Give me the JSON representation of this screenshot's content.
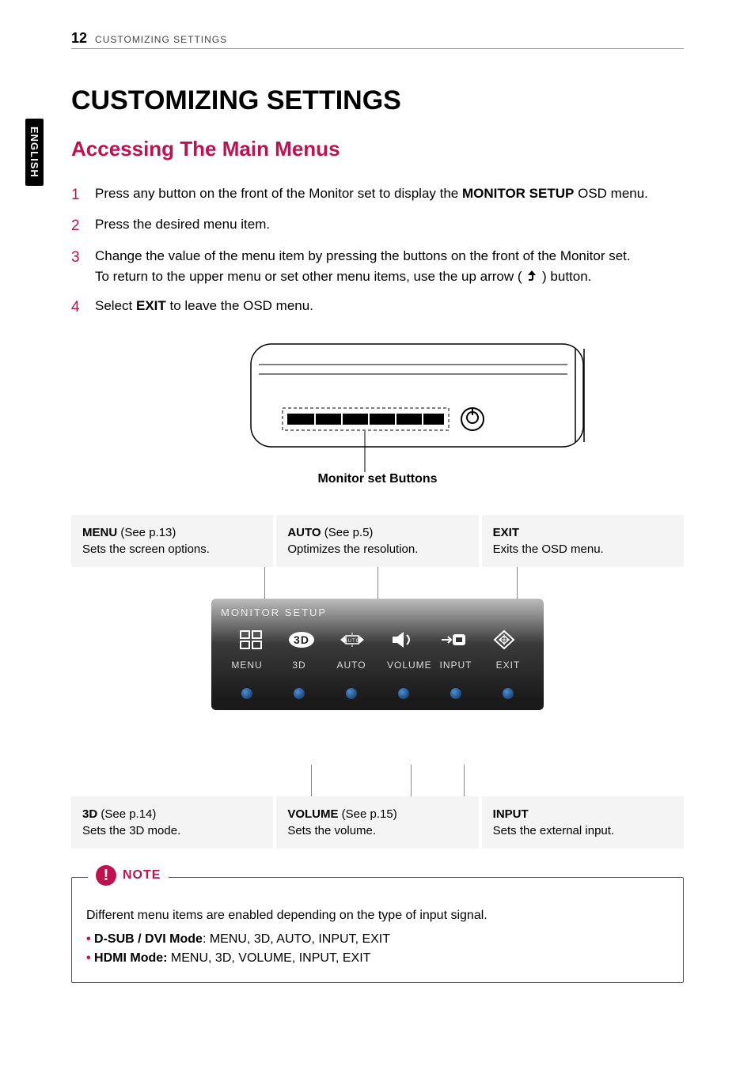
{
  "page": {
    "number": "12",
    "running_head": "CUSTOMIZING SETTINGS",
    "language_tab": "ENGLISH"
  },
  "title": "CUSTOMIZING SETTINGS",
  "section": "Accessing The Main Menus",
  "steps": [
    {
      "n": "1",
      "pre": "Press any button on the front of the Monitor set to display the ",
      "bold": "MONITOR SETUP",
      "post": " OSD menu."
    },
    {
      "n": "2",
      "pre": "Press the desired menu item.",
      "bold": "",
      "post": ""
    },
    {
      "n": "3",
      "pre": "Change the value of the menu item by pressing the buttons on the front of the Monitor set.",
      "bold": "",
      "post": "",
      "line2_pre": "To return to the upper menu or set other menu items, use the up arrow (",
      "line2_post": ") button."
    },
    {
      "n": "4",
      "pre": "Select ",
      "bold": "EXIT",
      "post": " to leave the OSD menu."
    }
  ],
  "figure_label": "Monitor set Buttons",
  "top_info": [
    {
      "title": "MENU",
      "see": " (See p.13)",
      "desc": "Sets the screen options."
    },
    {
      "title": "AUTO",
      "see": " (See p.5)",
      "desc": "Optimizes the resolution."
    },
    {
      "title": "EXIT",
      "see": "",
      "desc": "Exits the OSD menu."
    }
  ],
  "bot_info": [
    {
      "title": "3D",
      "see": " (See p.14)",
      "desc": "Sets the 3D mode."
    },
    {
      "title": "VOLUME",
      "see": " (See p.15)",
      "desc": "Sets the volume."
    },
    {
      "title": "INPUT",
      "see": "",
      "desc": "Sets the external input."
    }
  ],
  "osd": {
    "title": "MONITOR SETUP",
    "items": [
      "MENU",
      "3D",
      "AUTO",
      "VOLUME",
      "INPUT",
      "EXIT"
    ]
  },
  "note": {
    "label": "NOTE",
    "intro": "Different menu items are enabled depending on the type of input signal.",
    "bullets": [
      {
        "bold": "D-SUB / DVI Mode",
        "rest": ": MENU, 3D, AUTO, INPUT, EXIT"
      },
      {
        "bold": "HDMI Mode: ",
        "rest": "MENU, 3D, VOLUME, INPUT, EXIT"
      }
    ]
  }
}
